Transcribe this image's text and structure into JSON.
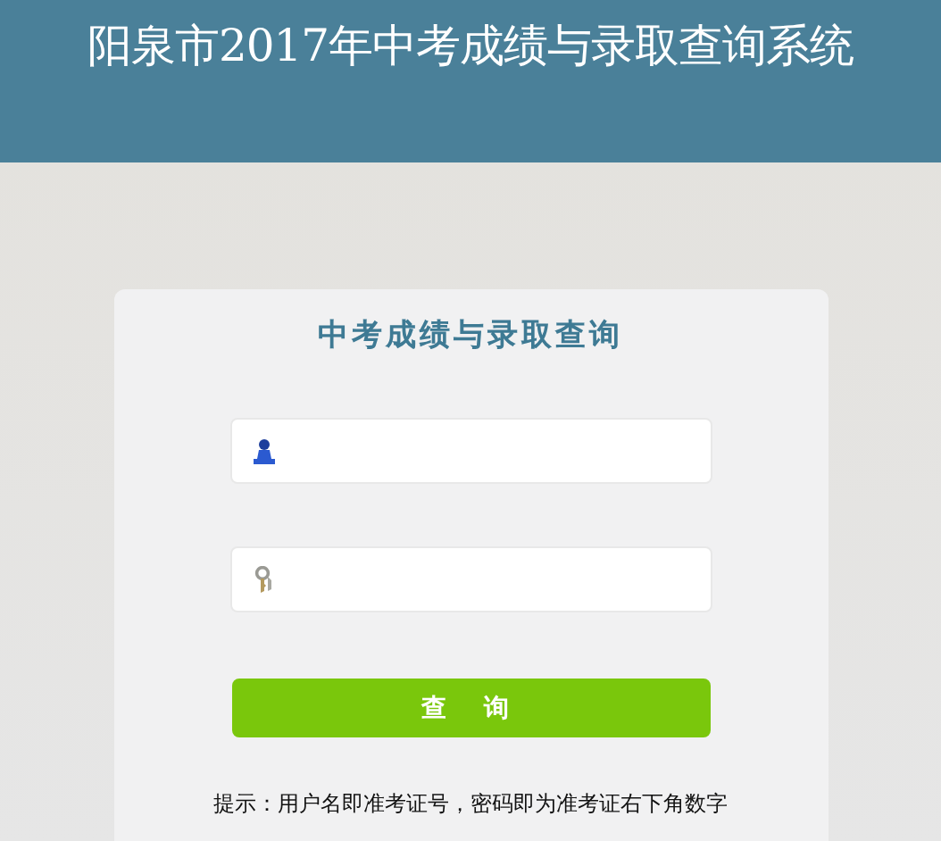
{
  "header": {
    "title": "阳泉市2017年中考成绩与录取查询系统"
  },
  "login": {
    "title": "中考成绩与录取查询",
    "fields": [
      {
        "kind": "user"
      },
      {
        "kind": "password"
      }
    ],
    "button": "查 询",
    "hint": "提示：用户名即准考证号，密码即为准考证右下角数字"
  }
}
